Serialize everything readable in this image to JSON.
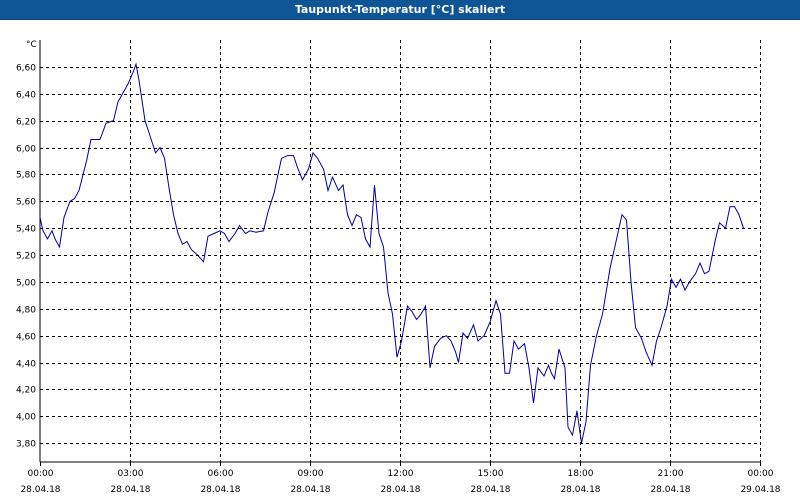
{
  "window": {
    "title": "Taupunkt-Temperatur [°C] skaliert"
  },
  "colors": {
    "title_bar": "#0f5596",
    "title_text": "#ffffff",
    "line": "#00009c",
    "grid": "#000000",
    "axis": "#000000"
  },
  "chart_data": {
    "type": "line",
    "title": "",
    "ylabel": "°C",
    "xlabel": "",
    "grid": true,
    "ylim": [
      3.66,
      6.8
    ],
    "xlim": [
      "28.04.18 00:00",
      "29.04.18 00:00"
    ],
    "yticks": [
      "6,60",
      "6,40",
      "6,20",
      "6,00",
      "5,80",
      "5,60",
      "5,40",
      "5,20",
      "5,00",
      "4,80",
      "4,60",
      "4,40",
      "4,20",
      "4,00",
      "3,80"
    ],
    "ytick_values": [
      6.6,
      6.4,
      6.2,
      6.0,
      5.8,
      5.6,
      5.4,
      5.2,
      5.0,
      4.8,
      4.6,
      4.4,
      4.2,
      4.0,
      3.8
    ],
    "xticks": [
      {
        "time": "00:00",
        "date": "28.04.18",
        "hours": 0
      },
      {
        "time": "03:00",
        "date": "28.04.18",
        "hours": 3
      },
      {
        "time": "06:00",
        "date": "28.04.18",
        "hours": 6
      },
      {
        "time": "09:00",
        "date": "28.04.18",
        "hours": 9
      },
      {
        "time": "12:00",
        "date": "28.04.18",
        "hours": 12
      },
      {
        "time": "15:00",
        "date": "28.04.18",
        "hours": 15
      },
      {
        "time": "18:00",
        "date": "28.04.18",
        "hours": 18
      },
      {
        "time": "21:00",
        "date": "28.04.18",
        "hours": 21
      },
      {
        "time": "00:00",
        "date": "29.04.18",
        "hours": 24
      }
    ],
    "series": [
      {
        "points": [
          [
            0.0,
            5.48
          ],
          [
            0.1,
            5.38
          ],
          [
            0.25,
            5.32
          ],
          [
            0.4,
            5.38
          ],
          [
            0.5,
            5.32
          ],
          [
            0.65,
            5.26
          ],
          [
            0.8,
            5.48
          ],
          [
            1.0,
            5.6
          ],
          [
            1.15,
            5.62
          ],
          [
            1.3,
            5.68
          ],
          [
            1.55,
            5.9
          ],
          [
            1.7,
            6.06
          ],
          [
            2.0,
            6.06
          ],
          [
            2.2,
            6.18
          ],
          [
            2.45,
            6.2
          ],
          [
            2.6,
            6.34
          ],
          [
            2.8,
            6.42
          ],
          [
            2.95,
            6.48
          ],
          [
            3.1,
            6.56
          ],
          [
            3.2,
            6.62
          ],
          [
            3.3,
            6.5
          ],
          [
            3.5,
            6.2
          ],
          [
            3.65,
            6.1
          ],
          [
            3.85,
            5.96
          ],
          [
            4.0,
            6.0
          ],
          [
            4.15,
            5.92
          ],
          [
            4.3,
            5.7
          ],
          [
            4.45,
            5.5
          ],
          [
            4.6,
            5.36
          ],
          [
            4.75,
            5.28
          ],
          [
            4.9,
            5.3
          ],
          [
            5.05,
            5.24
          ],
          [
            5.25,
            5.2
          ],
          [
            5.45,
            5.15
          ],
          [
            5.6,
            5.34
          ],
          [
            5.8,
            5.36
          ],
          [
            6.0,
            5.38
          ],
          [
            6.15,
            5.36
          ],
          [
            6.3,
            5.3
          ],
          [
            6.5,
            5.36
          ],
          [
            6.65,
            5.42
          ],
          [
            6.85,
            5.36
          ],
          [
            7.0,
            5.38
          ],
          [
            7.2,
            5.37
          ],
          [
            7.45,
            5.38
          ],
          [
            7.6,
            5.52
          ],
          [
            7.8,
            5.66
          ],
          [
            8.05,
            5.92
          ],
          [
            8.25,
            5.94
          ],
          [
            8.45,
            5.94
          ],
          [
            8.6,
            5.84
          ],
          [
            8.75,
            5.76
          ],
          [
            8.95,
            5.84
          ],
          [
            9.1,
            5.96
          ],
          [
            9.25,
            5.92
          ],
          [
            9.45,
            5.84
          ],
          [
            9.6,
            5.68
          ],
          [
            9.75,
            5.78
          ],
          [
            9.95,
            5.68
          ],
          [
            10.1,
            5.72
          ],
          [
            10.25,
            5.5
          ],
          [
            10.4,
            5.42
          ],
          [
            10.55,
            5.5
          ],
          [
            10.7,
            5.48
          ],
          [
            10.85,
            5.32
          ],
          [
            11.0,
            5.26
          ],
          [
            11.15,
            5.72
          ],
          [
            11.3,
            5.36
          ],
          [
            11.45,
            5.26
          ],
          [
            11.6,
            4.92
          ],
          [
            11.75,
            4.76
          ],
          [
            11.9,
            4.44
          ],
          [
            12.05,
            4.56
          ],
          [
            12.25,
            4.82
          ],
          [
            12.4,
            4.78
          ],
          [
            12.55,
            4.72
          ],
          [
            12.7,
            4.76
          ],
          [
            12.85,
            4.82
          ],
          [
            13.0,
            4.36
          ],
          [
            13.15,
            4.52
          ],
          [
            13.35,
            4.58
          ],
          [
            13.55,
            4.6
          ],
          [
            13.7,
            4.56
          ],
          [
            13.85,
            4.48
          ],
          [
            13.95,
            4.4
          ],
          [
            14.1,
            4.62
          ],
          [
            14.25,
            4.58
          ],
          [
            14.45,
            4.68
          ],
          [
            14.6,
            4.56
          ],
          [
            14.8,
            4.6
          ],
          [
            15.0,
            4.7
          ],
          [
            15.2,
            4.86
          ],
          [
            15.35,
            4.76
          ],
          [
            15.5,
            4.32
          ],
          [
            15.65,
            4.32
          ],
          [
            15.8,
            4.56
          ],
          [
            15.95,
            4.5
          ],
          [
            16.15,
            4.54
          ],
          [
            16.3,
            4.36
          ],
          [
            16.45,
            4.1
          ],
          [
            16.6,
            4.36
          ],
          [
            16.8,
            4.3
          ],
          [
            16.95,
            4.38
          ],
          [
            17.05,
            4.32
          ],
          [
            17.15,
            4.28
          ],
          [
            17.3,
            4.5
          ],
          [
            17.5,
            4.36
          ],
          [
            17.6,
            3.92
          ],
          [
            17.75,
            3.86
          ],
          [
            17.9,
            4.04
          ],
          [
            18.05,
            3.8
          ],
          [
            18.2,
            3.96
          ],
          [
            18.35,
            4.38
          ],
          [
            18.55,
            4.6
          ],
          [
            18.75,
            4.76
          ],
          [
            19.0,
            5.1
          ],
          [
            19.2,
            5.3
          ],
          [
            19.4,
            5.5
          ],
          [
            19.55,
            5.46
          ],
          [
            19.7,
            5.0
          ],
          [
            19.85,
            4.66
          ],
          [
            20.05,
            4.58
          ],
          [
            20.2,
            4.48
          ],
          [
            20.4,
            4.38
          ],
          [
            20.55,
            4.56
          ],
          [
            20.7,
            4.66
          ],
          [
            20.9,
            4.82
          ],
          [
            21.05,
            5.02
          ],
          [
            21.2,
            4.96
          ],
          [
            21.35,
            5.02
          ],
          [
            21.5,
            4.94
          ],
          [
            21.65,
            5.0
          ],
          [
            21.85,
            5.06
          ],
          [
            22.0,
            5.14
          ],
          [
            22.15,
            5.06
          ],
          [
            22.3,
            5.08
          ],
          [
            22.5,
            5.3
          ],
          [
            22.65,
            5.44
          ],
          [
            22.85,
            5.4
          ],
          [
            23.0,
            5.56
          ],
          [
            23.15,
            5.56
          ],
          [
            23.3,
            5.5
          ],
          [
            23.45,
            5.4
          ]
        ]
      }
    ]
  }
}
